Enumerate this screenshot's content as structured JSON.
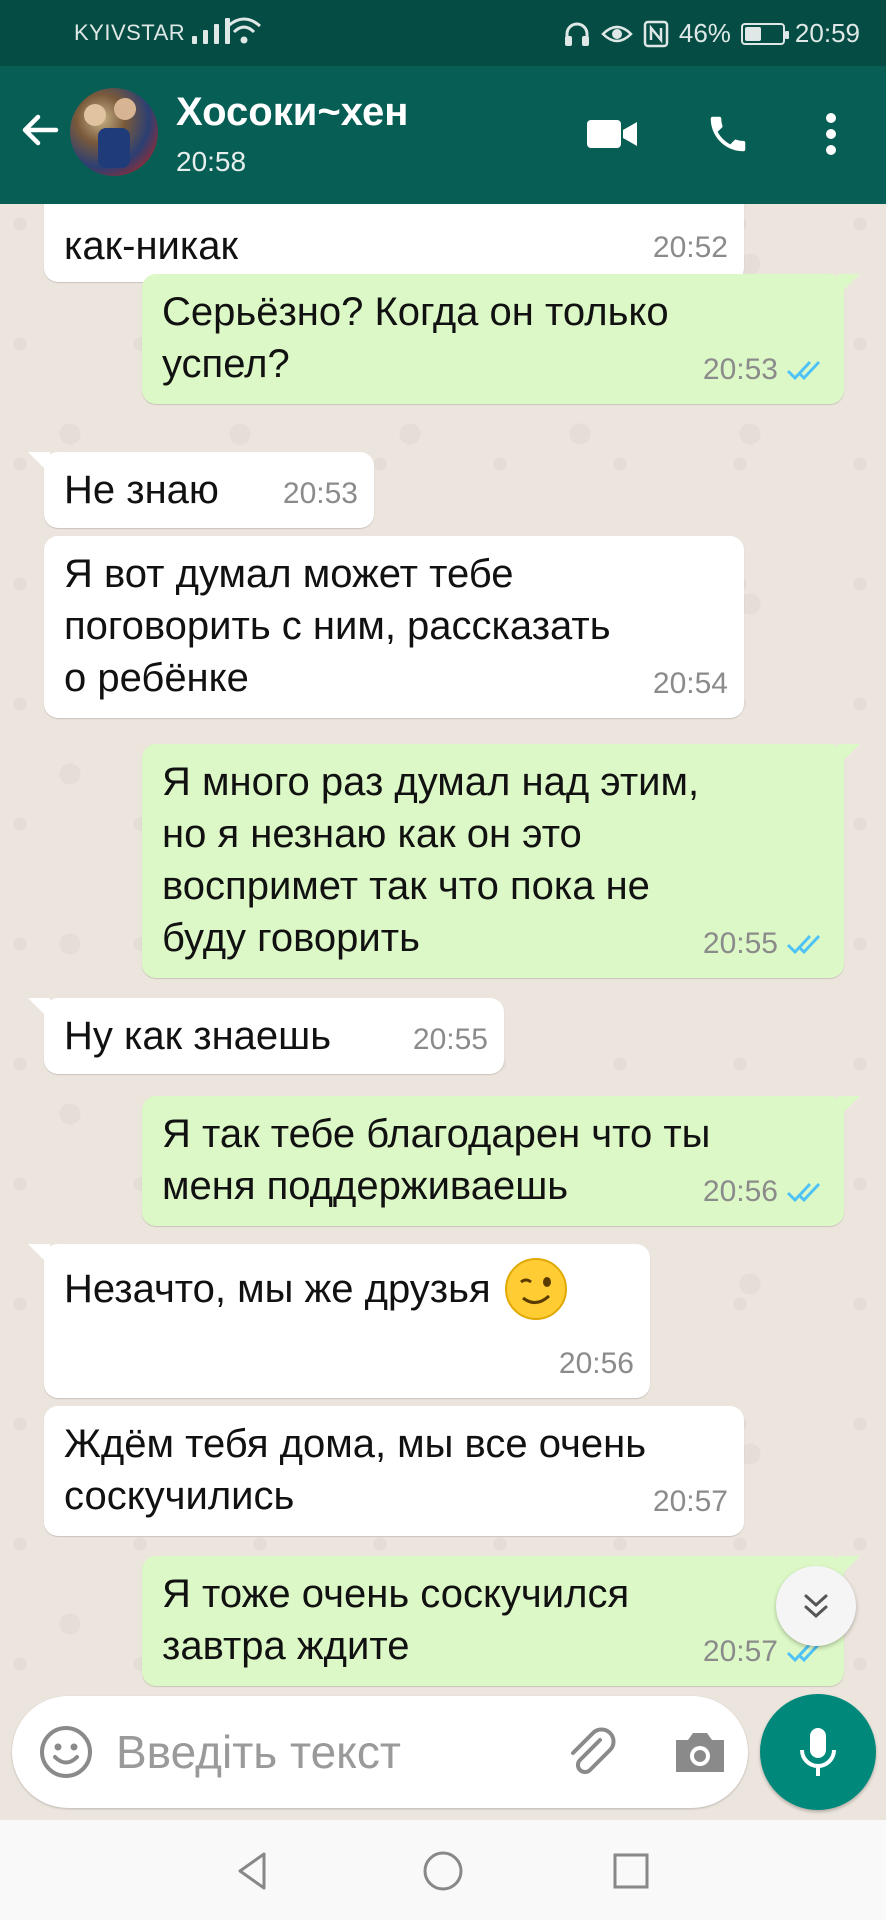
{
  "status_bar": {
    "carrier": "KYIVSTAR",
    "battery": "46%",
    "battery_level": 0.46,
    "time": "20:59"
  },
  "header": {
    "contact_name": "Хосоки~хен",
    "last_seen": "20:58"
  },
  "messages": [
    {
      "dir": "in",
      "text": "как-никак",
      "time": "20:52"
    },
    {
      "dir": "out",
      "text": "Серьёзно? Когда он только\nуспел?",
      "time": "20:53"
    },
    {
      "dir": "in",
      "text": "Не знаю",
      "time": "20:53"
    },
    {
      "dir": "in",
      "text": "Я вот думал может тебе\nпоговорить с ним, рассказать\nо ребёнке",
      "time": "20:54"
    },
    {
      "dir": "out",
      "text": "Я много раз думал над этим,\nно я незнаю как он это\nвоспримет так что пока не\nбуду говорить",
      "time": "20:55"
    },
    {
      "dir": "in",
      "text": "Ну как знаешь",
      "time": "20:55"
    },
    {
      "dir": "out",
      "text": "Я так тебе благодарен что ты\nменя поддерживаешь",
      "time": "20:56"
    },
    {
      "dir": "in",
      "text": "Незачто, мы же друзья",
      "time": "20:56"
    },
    {
      "dir": "in",
      "text": "Ждём тебя дома, мы все очень\nсоскучились",
      "time": "20:57"
    },
    {
      "dir": "out",
      "text": "Я тоже очень соскучился\nзавтра ждите",
      "time": "20:57"
    }
  ],
  "composer": {
    "placeholder": "Введіть текст"
  },
  "icons": {
    "back": "arrow-left-icon",
    "video": "video-call-icon",
    "call": "phone-icon",
    "menu": "more-vert-icon",
    "emoji": "emoji-icon",
    "attach": "paperclip-icon",
    "camera": "camera-icon",
    "mic": "mic-icon",
    "scroll": "double-chevron-down-icon",
    "read": "double-check-icon"
  },
  "colors": {
    "header": "#075e54",
    "status_bar": "#054d44",
    "incoming_bubble": "#ffffff",
    "outgoing_bubble": "#dcf8c6",
    "read_tick": "#4fc3f7",
    "fab": "#00897b"
  }
}
